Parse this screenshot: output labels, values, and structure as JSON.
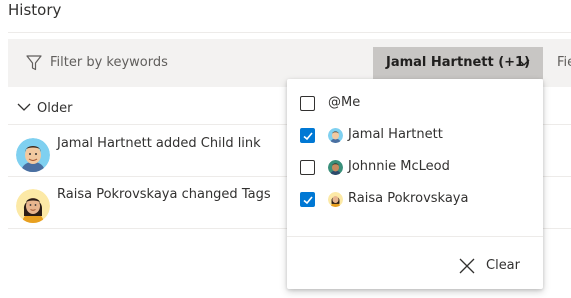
{
  "header": {
    "title": "History"
  },
  "filter_bar": {
    "keyword_placeholder": "Filter by keywords",
    "person_filter_label": "Jamal Hartnett (+1)",
    "next_filter_partial": "Fie"
  },
  "group": {
    "label": "Older"
  },
  "entries": [
    {
      "text": "Jamal Hartnett added Child link",
      "avatar": "jamal-avatar"
    },
    {
      "text": "Raisa Pokrovskaya changed Tags",
      "avatar": "raisa-avatar"
    }
  ],
  "dropdown": {
    "options": [
      {
        "label": "@Me",
        "checked": false,
        "avatar": null
      },
      {
        "label": "Jamal Hartnett",
        "checked": true,
        "avatar": "jamal-avatar"
      },
      {
        "label": "Johnnie McLeod",
        "checked": false,
        "avatar": "johnnie-avatar"
      },
      {
        "label": "Raisa Pokrovskaya",
        "checked": true,
        "avatar": "raisa-avatar"
      }
    ],
    "clear_label": "Clear"
  },
  "colors": {
    "accent": "#0078d4",
    "filter_bar_bg": "#f3f2f1",
    "active_filter_bg": "#c8c6c4"
  }
}
